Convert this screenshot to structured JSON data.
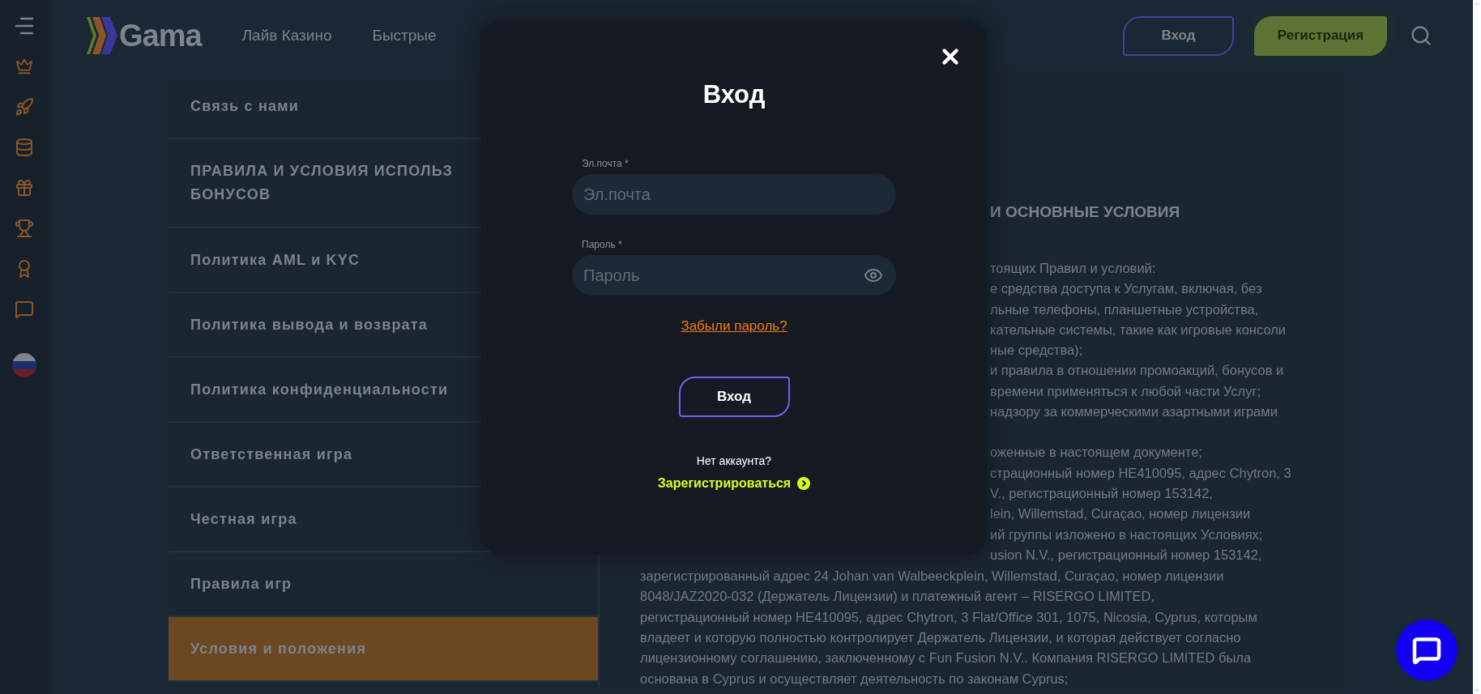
{
  "header": {
    "logo": "Gama",
    "nav": [
      "Лайв Казино",
      "Быстрые"
    ],
    "login_button": "Вход",
    "register_button": "Регистрация"
  },
  "menu": [
    {
      "label": "Связь с нами",
      "selected": false
    },
    {
      "label": "ПРАВИЛА И УСЛОВИЯ ИСПОЛЬЗ\nБОНУСОВ",
      "selected": false
    },
    {
      "label": "Политика AML и KYC",
      "selected": false
    },
    {
      "label": "Политика вывода и возврата",
      "selected": false
    },
    {
      "label": "Политика конфиденциальности",
      "selected": false
    },
    {
      "label": "Ответственная игра",
      "selected": false
    },
    {
      "label": "Честная игра",
      "selected": false
    },
    {
      "label": "Правила игр",
      "selected": false
    },
    {
      "label": "Условия и положения",
      "selected": true
    }
  ],
  "content": {
    "heading": "И ОСНОВНЫЕ УСЛОВИЯ",
    "fragments": [
      [
        "тоящих Правил и условий:",
        "е средства доступа к Услугам, включая, без",
        "льные телефоны, планшетные устройства,",
        "кательные системы, такие как игровые консоли",
        "ные средства);",
        "и правила в отношении промоакций, бонусов и",
        "времени применяться к любой части Услуг;",
        "надзору за коммерческими азартными играми"
      ],
      [
        "оженные в настоящем документе;",
        "страционный номер HE410095, адрес Chytron, 3",
        "V., регистрационный номер 153142,",
        "lein, Willemstad, Curaçao, номер лицензии",
        "ий группы изложено в настоящих Условиях;",
        "usion N.V., регистрационный номер 153142,"
      ]
    ],
    "lines": [
      "зарегистрированный адрес 24 Johan van Walbeeckplein, Willemstad, Curaçao, номер лицензии",
      "8048/JAZ2020-032 (Держатель Лицензии) и платежный агент  – RISERGO LIMITED,",
      "регистрационный номер HE410095, адрес Chytron, 3 Flat/Office 301, 1075, Nicosia, Cyprus, которым",
      "владеет и которую полностью контролирует Держатель Лицензии, и которая действует согласно",
      "лицензионному соглашению, заключенному с Fun Fusion N.V.. Компания RISERGO LIMITED была",
      "основана в Cyprus и осуществляет деятельность по законам Cyprus;"
    ]
  },
  "modal": {
    "title": "Вход",
    "fields": [
      {
        "kind": "email",
        "label": "Эл.почта *",
        "placeholder": "Эл.почта"
      },
      {
        "kind": "password",
        "label": "Пароль *",
        "placeholder": "Пароль"
      }
    ],
    "forgot_link": "Забыли пароль?",
    "submit": "Вход",
    "no_account": "Нет аккаунта?",
    "register_link": "Зарегистрироваться"
  }
}
